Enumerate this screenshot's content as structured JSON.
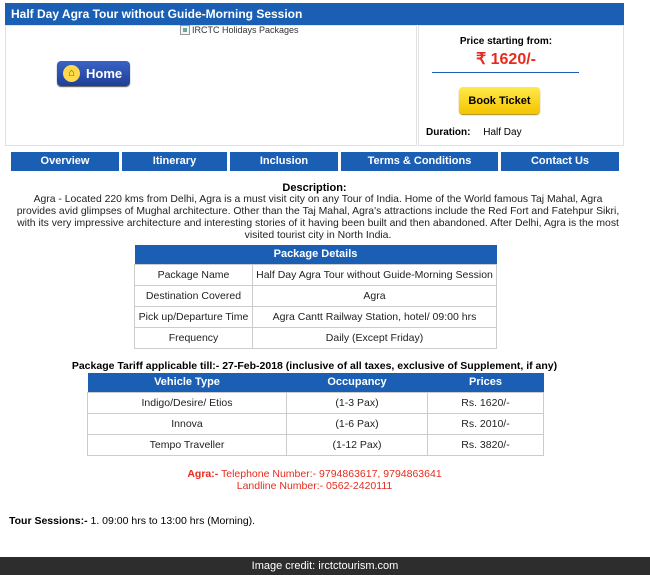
{
  "header": {
    "title": "Half Day Agra Tour without Guide-Morning Session"
  },
  "logo": {
    "alt_text": "IRCTC Holidays Packages"
  },
  "home_button": {
    "label": "Home"
  },
  "price": {
    "label": "Price starting from:",
    "value": "₹ 1620/-"
  },
  "book_button": {
    "label": "Book Ticket"
  },
  "duration": {
    "label": "Duration:",
    "value": "Half Day"
  },
  "tabs": [
    {
      "label": "Overview"
    },
    {
      "label": "Itinerary"
    },
    {
      "label": "Inclusion"
    },
    {
      "label": "Terms & Conditions"
    },
    {
      "label": "Contact Us"
    }
  ],
  "description": {
    "title": "Description:",
    "text": "Agra - Located 220 kms from Delhi, Agra is a must visit city on any Tour of India. Home of the World famous Taj Mahal, Agra provides avid glimpses of Mughal architecture. Other than the Taj Mahal, Agra's attractions include the Red Fort and Fatehpur Sikri, with its very impressive architecture and interesting stories of it having been built and then abandoned. After Delhi, Agra is the most visited tourist city in North India."
  },
  "package_details": {
    "heading": "Package Details",
    "rows": [
      {
        "key": "Package Name",
        "value": "Half Day Agra Tour without Guide-Morning Session"
      },
      {
        "key": "Destination Covered",
        "value": "Agra"
      },
      {
        "key": "Pick up/Departure Time",
        "value": "Agra Cantt Railway Station, hotel/ 09:00 hrs"
      },
      {
        "key": "Frequency",
        "value": "Daily (Except Friday)"
      }
    ]
  },
  "tariff": {
    "title": "Package Tariff applicable till:- 27-Feb-2018 (inclusive of all taxes, exclusive of Supplement, if any)",
    "headers": [
      "Vehicle Type",
      "Occupancy",
      "Prices"
    ],
    "rows": [
      {
        "vehicle": "Indigo/Desire/ Etios",
        "occupancy": "(1-3 Pax)",
        "price": "Rs. 1620/-"
      },
      {
        "vehicle": "Innova",
        "occupancy": "(1-6 Pax)",
        "price": "Rs. 2010/-"
      },
      {
        "vehicle": "Tempo Traveller",
        "occupancy": "(1-12 Pax)",
        "price": "Rs. 3820/-"
      }
    ]
  },
  "contact": {
    "city": "Agra:-",
    "telephone": "Telephone Number:- 9794863617, 9794863641",
    "landline": "Landline Number:- 0562-2420111"
  },
  "sessions": {
    "label": "Tour Sessions:-",
    "value": "1. 09:00 hrs to 13:00 hrs (Morning)."
  },
  "credit": {
    "text": "Image credit: irctctourism.com"
  },
  "colors": {
    "primary": "#1a5fb4",
    "price_red": "#e62b1e",
    "book_yellow": "#f5c400"
  }
}
